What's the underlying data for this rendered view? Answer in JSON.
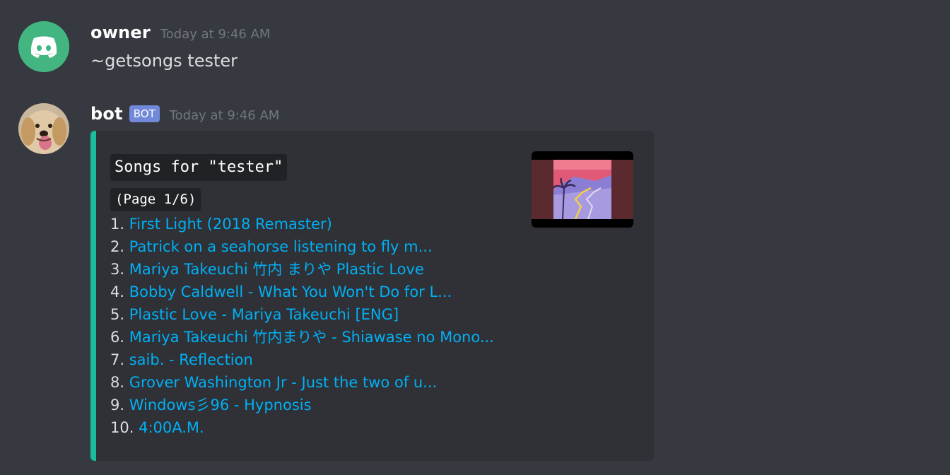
{
  "messages": [
    {
      "username": "owner",
      "timestamp": "Today at 9:46 AM",
      "content": "~getsongs tester",
      "avatar_icon": "discord-logo-icon"
    },
    {
      "username": "bot",
      "bot_tag": "BOT",
      "timestamp": "Today at 9:46 AM",
      "avatar_icon": "dog-avatar-icon",
      "embed": {
        "accent_color": "#1abc9c",
        "title": "Songs for \"tester\"",
        "page": "(Page 1/6)",
        "songs": [
          {
            "num": "1.",
            "title": "First Light (2018 Remaster)"
          },
          {
            "num": "2.",
            "title": "Patrick on a seahorse listening to fly m..."
          },
          {
            "num": "3.",
            "title": "Mariya Takeuchi 竹内 まりや Plastic Love"
          },
          {
            "num": "4.",
            "title": "Bobby Caldwell - What You Won't Do for L..."
          },
          {
            "num": "5.",
            "title": "Plastic Love - Mariya Takeuchi [ENG]"
          },
          {
            "num": "6.",
            "title": "Mariya Takeuchi 竹内まりや - Shiawase no Mono..."
          },
          {
            "num": "7.",
            "title": "saib. - Reflection"
          },
          {
            "num": "8.",
            "title": "Grover Washington Jr - Just the two of u..."
          },
          {
            "num": "9.",
            "title": "Windows彡96 - Hypnosis"
          },
          {
            "num": "10.",
            "title": "4:00A.M."
          }
        ]
      }
    }
  ],
  "colors": {
    "background": "#36393f",
    "embed_bg": "#2f3136",
    "link": "#00b0f4",
    "bot_tag": "#7289da",
    "discord_green": "#43b581"
  }
}
